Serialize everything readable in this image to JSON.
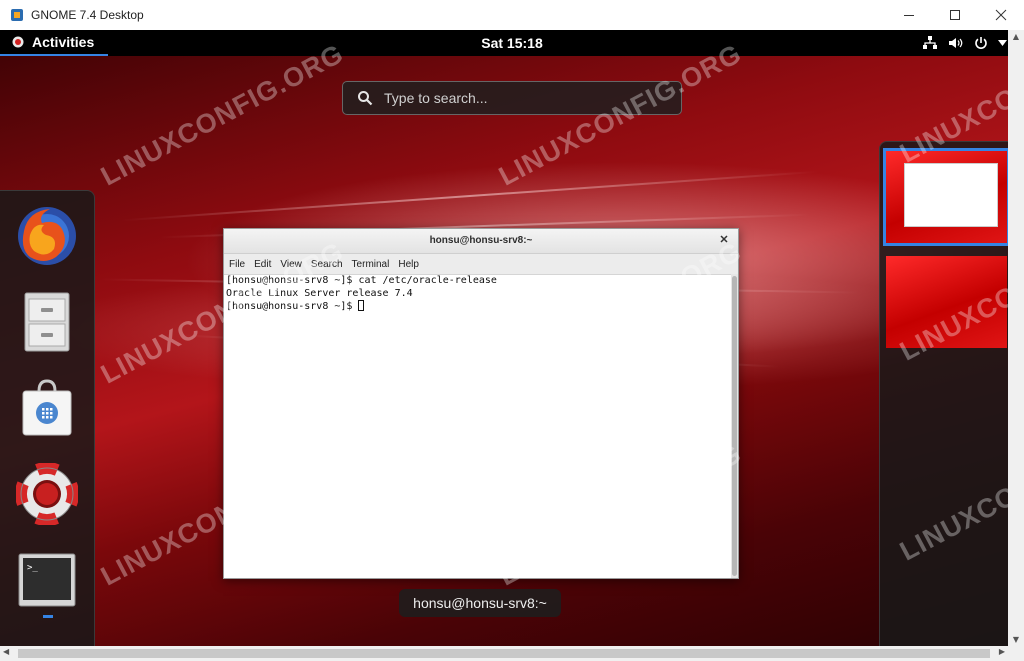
{
  "host_window": {
    "title": "GNOME 7.4 Desktop",
    "minimize_icon": "minimize-icon",
    "maximize_icon": "maximize-icon",
    "close_icon": "close-icon"
  },
  "topbar": {
    "activities_label": "Activities",
    "clock": "Sat 15:18",
    "tray_icons": [
      "network-icon",
      "volume-icon",
      "power-icon",
      "chevron-down-icon"
    ]
  },
  "search": {
    "placeholder": "Type to search..."
  },
  "dash": {
    "apps": [
      "firefox-icon",
      "files-icon",
      "software-icon",
      "help-icon",
      "terminal-icon"
    ]
  },
  "terminal": {
    "title": "honsu@honsu-srv8:~",
    "menu": [
      "File",
      "Edit",
      "View",
      "Search",
      "Terminal",
      "Help"
    ],
    "lines": [
      "[honsu@honsu-srv8 ~]$ cat /etc/oracle-release",
      "Oracle Linux Server release 7.4",
      "[honsu@honsu-srv8 ~]$ "
    ]
  },
  "window_caption": "honsu@honsu-srv8:~",
  "watermark": "LINUXCONFIG.ORG",
  "colors": {
    "accent": "#3584e4",
    "topbar": "#000000",
    "desktop_red": "#b3151a"
  }
}
